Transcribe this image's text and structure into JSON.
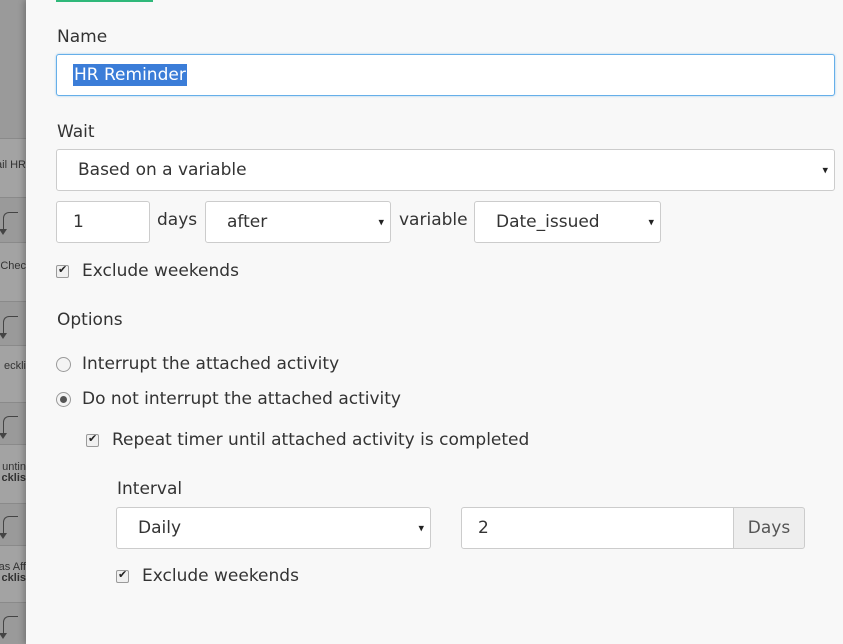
{
  "background": {
    "node_texts": [
      "ail HR",
      "Chec",
      "eckli",
      "untin",
      "cklis",
      "as Aff",
      "cklis"
    ]
  },
  "form": {
    "name": {
      "label": "Name",
      "value": "HR Reminder"
    },
    "wait": {
      "label": "Wait",
      "mode": "Based on a variable",
      "amount": "1",
      "unit_label": "days",
      "direction": "after",
      "variable_label": "variable",
      "variable": "Date_issued",
      "exclude_weekends_label": "Exclude weekends",
      "exclude_weekends": true
    },
    "options": {
      "label": "Options",
      "interrupt_label": "Interrupt the attached activity",
      "no_interrupt_label": "Do not interrupt the attached activity",
      "selected": "no_interrupt",
      "repeat_label": "Repeat timer until attached activity is completed",
      "repeat": true
    },
    "interval": {
      "label": "Interval",
      "frequency": "Daily",
      "value": "2",
      "unit": "Days",
      "exclude_weekends_label": "Exclude weekends",
      "exclude_weekends": true
    }
  },
  "colors": {
    "accent": "#2fb87a",
    "focus_border": "#66afe9",
    "selection": "#3b7dd8"
  },
  "icons": {
    "select_caret": "▾"
  }
}
